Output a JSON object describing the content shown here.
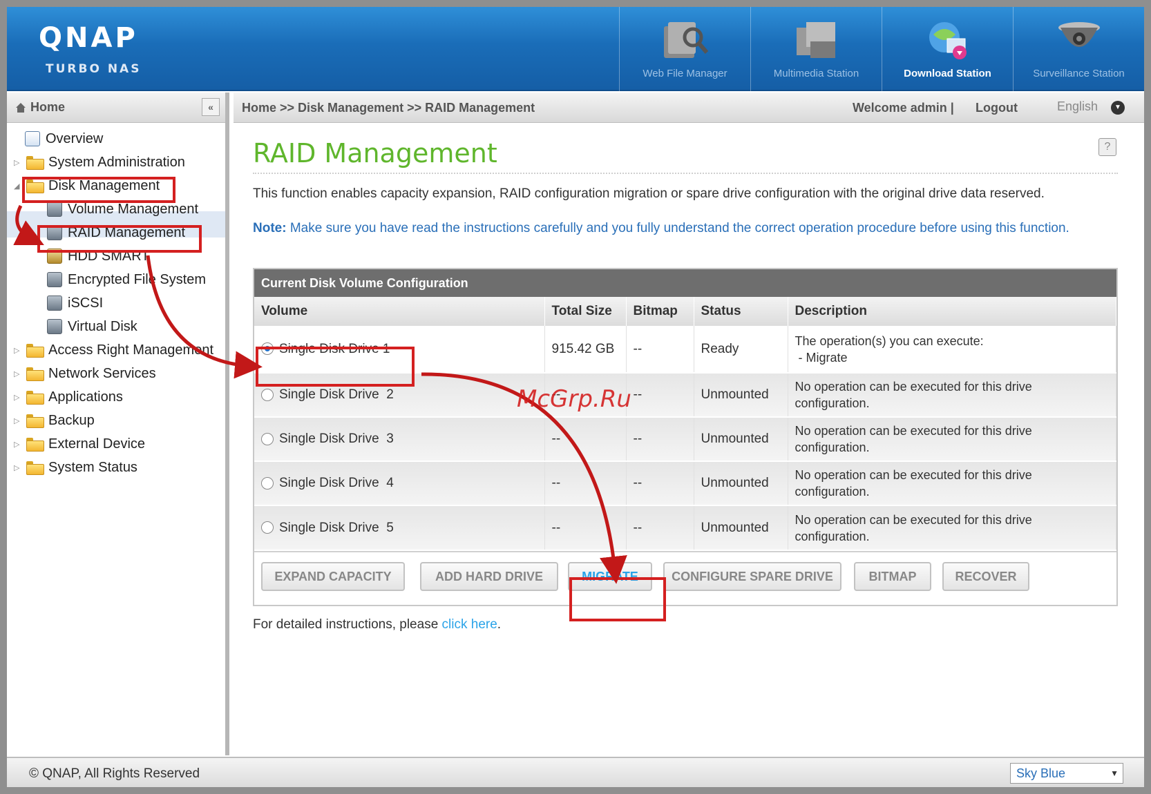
{
  "header": {
    "logo": "QNAP",
    "logo_sub": "TURBO NAS",
    "apps": [
      {
        "label": "Web File Manager",
        "icon": "file-manager-icon"
      },
      {
        "label": "Multimedia Station",
        "icon": "multimedia-icon"
      },
      {
        "label": "Download Station",
        "icon": "download-icon"
      },
      {
        "label": "Surveillance Station",
        "icon": "camera-icon"
      }
    ]
  },
  "sidebar": {
    "title": "Home",
    "collapse": "«",
    "items": [
      {
        "label": "Overview"
      },
      {
        "label": "System Administration"
      },
      {
        "label": "Disk Management"
      },
      {
        "label": "Volume Management"
      },
      {
        "label": "RAID Management"
      },
      {
        "label": "HDD SMART"
      },
      {
        "label": "Encrypted File System"
      },
      {
        "label": "iSCSI"
      },
      {
        "label": "Virtual Disk"
      },
      {
        "label": "Access Right Management"
      },
      {
        "label": "Network Services"
      },
      {
        "label": "Applications"
      },
      {
        "label": "Backup"
      },
      {
        "label": "External Device"
      },
      {
        "label": "System Status"
      }
    ]
  },
  "topbar": {
    "breadcrumb": "Home >> Disk Management >> RAID Management",
    "welcome": "Welcome admin",
    "separator": "|",
    "logout": "Logout",
    "language": "English"
  },
  "main": {
    "title": "RAID Management",
    "help": "?",
    "description": "This function enables capacity expansion, RAID configuration migration or spare drive configuration with the original drive data reserved.",
    "note_label": "Note:",
    "note_text": " Make sure you have read the instructions carefully and you fully understand the correct operation procedure before using this function.",
    "panel_title": "Current Disk Volume Configuration",
    "columns": [
      "Volume",
      "Total Size",
      "Bitmap",
      "Status",
      "Description"
    ],
    "rows": [
      {
        "volume": "Single Disk Drive 1",
        "size": "915.42 GB",
        "bitmap": "--",
        "status": "Ready",
        "desc1": "The operation(s) you can execute:",
        "desc2": " - Migrate"
      },
      {
        "volume": "Single Disk Drive  2",
        "size": "--",
        "bitmap": "--",
        "status": "Unmounted",
        "desc1": "No operation can be executed for this drive",
        "desc2": "configuration."
      },
      {
        "volume": "Single Disk Drive  3",
        "size": "--",
        "bitmap": "--",
        "status": "Unmounted",
        "desc1": "No operation can be executed for this drive",
        "desc2": "configuration."
      },
      {
        "volume": "Single Disk Drive  4",
        "size": "--",
        "bitmap": "--",
        "status": "Unmounted",
        "desc1": "No operation can be executed for this drive",
        "desc2": "configuration."
      },
      {
        "volume": "Single Disk Drive  5",
        "size": "--",
        "bitmap": "--",
        "status": "Unmounted",
        "desc1": "No operation can be executed for this drive",
        "desc2": "configuration."
      }
    ],
    "buttons": {
      "expand": "EXPAND CAPACITY",
      "add": "ADD HARD DRIVE",
      "migrate": "MIGRATE",
      "spare": "CONFIGURE SPARE DRIVE",
      "bitmap": "BITMAP",
      "recover": "RECOVER"
    },
    "footer_text": "For detailed instructions, please ",
    "footer_link": "click here",
    "footer_end": "."
  },
  "footer": {
    "copyright": "© QNAP, All Rights Reserved",
    "theme": "Sky Blue"
  },
  "watermark": "McGrp.Ru",
  "colors": {
    "accent_green": "#5fb62c",
    "header_blue": "#1a6db8",
    "annotation_red": "#d42020",
    "link_blue": "#2aa3e8"
  }
}
